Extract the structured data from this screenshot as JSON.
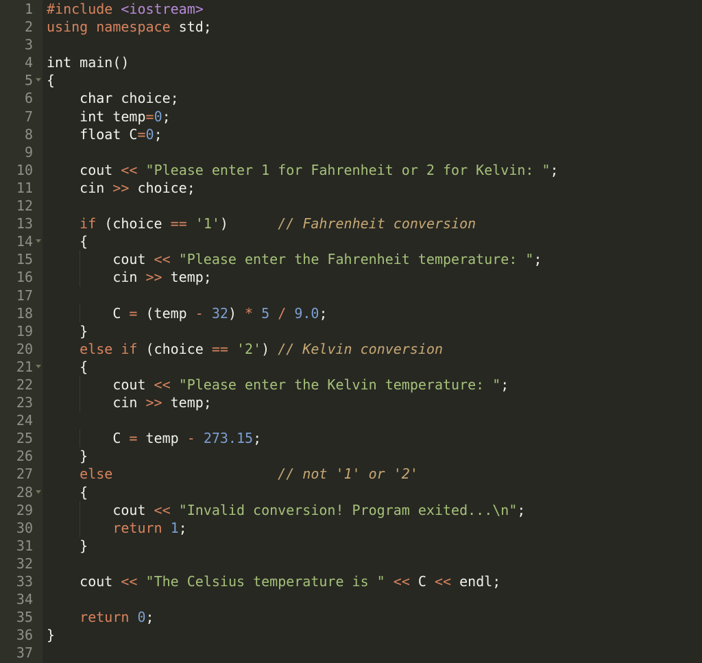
{
  "editor": {
    "language": "C++",
    "colors": {
      "background": "#272822",
      "gutter": "#2f3129",
      "line_number": "#8f908a",
      "keyword": "#d9845e",
      "string": "#a6c17a",
      "number": "#7c9fd1",
      "comment": "#c7a875",
      "include": "#b98ad8",
      "text": "#f1f1ea"
    },
    "folded_lines": [
      5,
      14,
      21,
      28
    ],
    "lines": [
      {
        "n": "1",
        "indent": 0,
        "tokens": [
          {
            "t": "preproc",
            "v": "#include "
          },
          {
            "t": "include",
            "v": "<iostream>"
          }
        ]
      },
      {
        "n": "2",
        "indent": 0,
        "tokens": [
          {
            "t": "keyword",
            "v": "using namespace "
          },
          {
            "t": "text",
            "v": "std;"
          }
        ]
      },
      {
        "n": "3",
        "indent": 0,
        "tokens": []
      },
      {
        "n": "4",
        "indent": 0,
        "tokens": [
          {
            "t": "type",
            "v": "int "
          },
          {
            "t": "text",
            "v": "main()"
          }
        ]
      },
      {
        "n": "5",
        "indent": 0,
        "tokens": [
          {
            "t": "punct",
            "v": "{"
          }
        ]
      },
      {
        "n": "6",
        "indent": 1,
        "tokens": [
          {
            "t": "type",
            "v": "char "
          },
          {
            "t": "text",
            "v": "choice;"
          }
        ]
      },
      {
        "n": "7",
        "indent": 1,
        "tokens": [
          {
            "t": "type",
            "v": "int "
          },
          {
            "t": "text",
            "v": "temp"
          },
          {
            "t": "op",
            "v": "="
          },
          {
            "t": "number",
            "v": "0"
          },
          {
            "t": "text",
            "v": ";"
          }
        ]
      },
      {
        "n": "8",
        "indent": 1,
        "tokens": [
          {
            "t": "type",
            "v": "float "
          },
          {
            "t": "text",
            "v": "C"
          },
          {
            "t": "op",
            "v": "="
          },
          {
            "t": "number",
            "v": "0"
          },
          {
            "t": "text",
            "v": ";"
          }
        ]
      },
      {
        "n": "9",
        "indent": 0,
        "tokens": []
      },
      {
        "n": "10",
        "indent": 1,
        "tokens": [
          {
            "t": "text",
            "v": "cout "
          },
          {
            "t": "op",
            "v": "<<"
          },
          {
            "t": "text",
            "v": " "
          },
          {
            "t": "string",
            "v": "\"Please enter 1 for Fahrenheit or 2 for Kelvin: \""
          },
          {
            "t": "text",
            "v": ";"
          }
        ]
      },
      {
        "n": "11",
        "indent": 1,
        "tokens": [
          {
            "t": "text",
            "v": "cin "
          },
          {
            "t": "op",
            "v": ">>"
          },
          {
            "t": "text",
            "v": " choice;"
          }
        ]
      },
      {
        "n": "12",
        "indent": 0,
        "tokens": []
      },
      {
        "n": "13",
        "indent": 1,
        "tokens": [
          {
            "t": "keyword",
            "v": "if"
          },
          {
            "t": "text",
            "v": " (choice "
          },
          {
            "t": "op",
            "v": "=="
          },
          {
            "t": "text",
            "v": " "
          },
          {
            "t": "char",
            "v": "'1'"
          },
          {
            "t": "text",
            "v": ")      "
          },
          {
            "t": "comment",
            "v": "// Fahrenheit conversion"
          }
        ]
      },
      {
        "n": "14",
        "indent": 1,
        "tokens": [
          {
            "t": "punct",
            "v": "{"
          }
        ]
      },
      {
        "n": "15",
        "indent": 2,
        "tokens": [
          {
            "t": "text",
            "v": "cout "
          },
          {
            "t": "op",
            "v": "<<"
          },
          {
            "t": "text",
            "v": " "
          },
          {
            "t": "string",
            "v": "\"Please enter the Fahrenheit temperature: \""
          },
          {
            "t": "text",
            "v": ";"
          }
        ]
      },
      {
        "n": "16",
        "indent": 2,
        "tokens": [
          {
            "t": "text",
            "v": "cin "
          },
          {
            "t": "op",
            "v": ">>"
          },
          {
            "t": "text",
            "v": " temp;"
          }
        ]
      },
      {
        "n": "17",
        "indent": 0,
        "tokens": []
      },
      {
        "n": "18",
        "indent": 2,
        "tokens": [
          {
            "t": "text",
            "v": "C "
          },
          {
            "t": "op",
            "v": "="
          },
          {
            "t": "text",
            "v": " (temp "
          },
          {
            "t": "op",
            "v": "-"
          },
          {
            "t": "text",
            "v": " "
          },
          {
            "t": "number",
            "v": "32"
          },
          {
            "t": "text",
            "v": ") "
          },
          {
            "t": "op",
            "v": "*"
          },
          {
            "t": "text",
            "v": " "
          },
          {
            "t": "number",
            "v": "5"
          },
          {
            "t": "text",
            "v": " "
          },
          {
            "t": "op",
            "v": "/"
          },
          {
            "t": "text",
            "v": " "
          },
          {
            "t": "number",
            "v": "9.0"
          },
          {
            "t": "text",
            "v": ";"
          }
        ]
      },
      {
        "n": "19",
        "indent": 1,
        "tokens": [
          {
            "t": "punct",
            "v": "}"
          }
        ]
      },
      {
        "n": "20",
        "indent": 1,
        "tokens": [
          {
            "t": "keyword",
            "v": "else if"
          },
          {
            "t": "text",
            "v": " (choice "
          },
          {
            "t": "op",
            "v": "=="
          },
          {
            "t": "text",
            "v": " "
          },
          {
            "t": "char",
            "v": "'2'"
          },
          {
            "t": "text",
            "v": ") "
          },
          {
            "t": "comment",
            "v": "// Kelvin conversion"
          }
        ]
      },
      {
        "n": "21",
        "indent": 1,
        "tokens": [
          {
            "t": "punct",
            "v": "{"
          }
        ]
      },
      {
        "n": "22",
        "indent": 2,
        "tokens": [
          {
            "t": "text",
            "v": "cout "
          },
          {
            "t": "op",
            "v": "<<"
          },
          {
            "t": "text",
            "v": " "
          },
          {
            "t": "string",
            "v": "\"Please enter the Kelvin temperature: \""
          },
          {
            "t": "text",
            "v": ";"
          }
        ]
      },
      {
        "n": "23",
        "indent": 2,
        "tokens": [
          {
            "t": "text",
            "v": "cin "
          },
          {
            "t": "op",
            "v": ">>"
          },
          {
            "t": "text",
            "v": " temp;"
          }
        ]
      },
      {
        "n": "24",
        "indent": 0,
        "tokens": []
      },
      {
        "n": "25",
        "indent": 2,
        "tokens": [
          {
            "t": "text",
            "v": "C "
          },
          {
            "t": "op",
            "v": "="
          },
          {
            "t": "text",
            "v": " temp "
          },
          {
            "t": "op",
            "v": "-"
          },
          {
            "t": "text",
            "v": " "
          },
          {
            "t": "number",
            "v": "273.15"
          },
          {
            "t": "text",
            "v": ";"
          }
        ]
      },
      {
        "n": "26",
        "indent": 1,
        "tokens": [
          {
            "t": "punct",
            "v": "}"
          }
        ]
      },
      {
        "n": "27",
        "indent": 1,
        "tokens": [
          {
            "t": "keyword",
            "v": "else"
          },
          {
            "t": "text",
            "v": "                    "
          },
          {
            "t": "comment",
            "v": "// not '1' or '2'"
          }
        ]
      },
      {
        "n": "28",
        "indent": 1,
        "tokens": [
          {
            "t": "punct",
            "v": "{"
          }
        ]
      },
      {
        "n": "29",
        "indent": 2,
        "tokens": [
          {
            "t": "text",
            "v": "cout "
          },
          {
            "t": "op",
            "v": "<<"
          },
          {
            "t": "text",
            "v": " "
          },
          {
            "t": "string",
            "v": "\"Invalid conversion! Program exited...\\n\""
          },
          {
            "t": "text",
            "v": ";"
          }
        ]
      },
      {
        "n": "30",
        "indent": 2,
        "tokens": [
          {
            "t": "keyword",
            "v": "return"
          },
          {
            "t": "text",
            "v": " "
          },
          {
            "t": "number",
            "v": "1"
          },
          {
            "t": "text",
            "v": ";"
          }
        ]
      },
      {
        "n": "31",
        "indent": 1,
        "tokens": [
          {
            "t": "punct",
            "v": "}"
          }
        ]
      },
      {
        "n": "32",
        "indent": 0,
        "tokens": []
      },
      {
        "n": "33",
        "indent": 1,
        "tokens": [
          {
            "t": "text",
            "v": "cout "
          },
          {
            "t": "op",
            "v": "<<"
          },
          {
            "t": "text",
            "v": " "
          },
          {
            "t": "string",
            "v": "\"The Celsius temperature is \""
          },
          {
            "t": "text",
            "v": " "
          },
          {
            "t": "op",
            "v": "<<"
          },
          {
            "t": "text",
            "v": " C "
          },
          {
            "t": "op",
            "v": "<<"
          },
          {
            "t": "text",
            "v": " endl;"
          }
        ]
      },
      {
        "n": "34",
        "indent": 0,
        "tokens": []
      },
      {
        "n": "35",
        "indent": 1,
        "tokens": [
          {
            "t": "keyword",
            "v": "return"
          },
          {
            "t": "text",
            "v": " "
          },
          {
            "t": "number",
            "v": "0"
          },
          {
            "t": "text",
            "v": ";"
          }
        ]
      },
      {
        "n": "36",
        "indent": 0,
        "tokens": [
          {
            "t": "punct",
            "v": "}"
          }
        ]
      },
      {
        "n": "37",
        "indent": 0,
        "tokens": []
      }
    ]
  }
}
